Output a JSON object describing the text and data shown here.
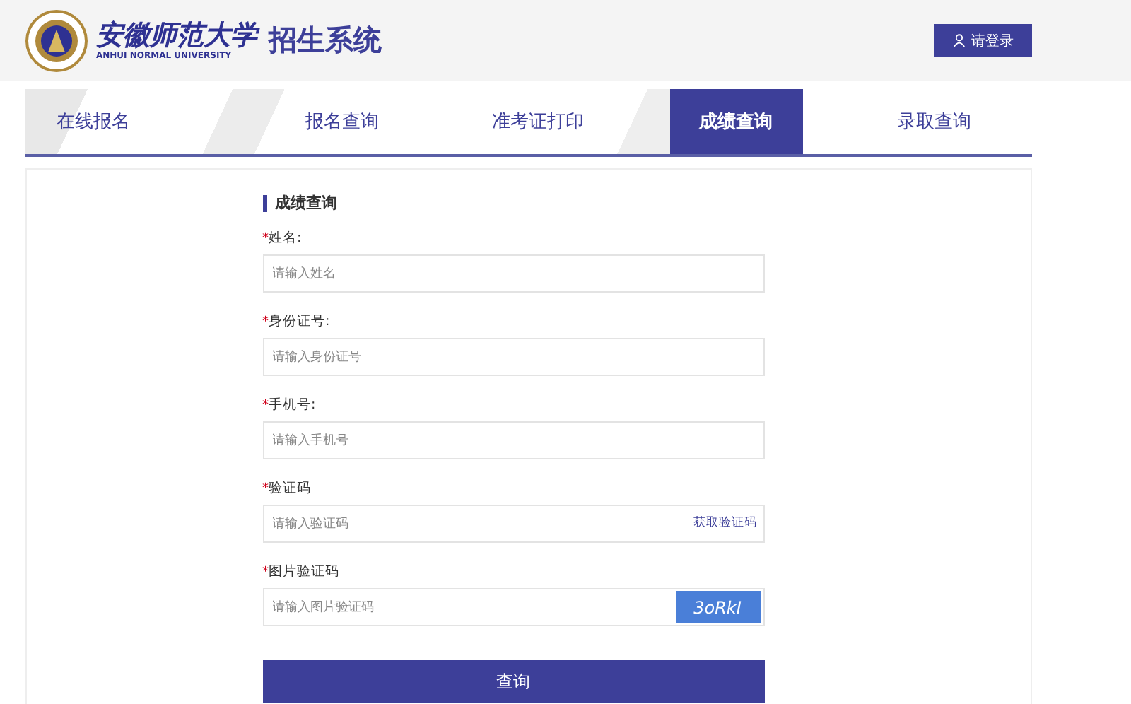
{
  "header": {
    "logo_name": "安徽师范大学",
    "logo_subtitle": "ANHUI NORMAL UNIVERSITY",
    "system_title": "招生系统",
    "login_button": "请登录"
  },
  "tabs": [
    {
      "label": "在线报名",
      "selected": false
    },
    {
      "label": "报名查询",
      "selected": false
    },
    {
      "label": "准考证打印",
      "selected": false
    },
    {
      "label": "成绩查询",
      "selected": true
    },
    {
      "label": "录取查询",
      "selected": false
    }
  ],
  "form": {
    "title": "成绩查询",
    "fields": [
      {
        "kind": "plain",
        "required_mark": "*",
        "label": "姓名:",
        "placeholder": "请输入姓名"
      },
      {
        "kind": "plain",
        "required_mark": "*",
        "label": "身份证号:",
        "placeholder": "请输入身份证号"
      },
      {
        "kind": "plain",
        "required_mark": "*",
        "label": "手机号:",
        "placeholder": "请输入手机号"
      },
      {
        "kind": "sms",
        "required_mark": "*",
        "label": "验证码",
        "placeholder": "请输入验证码",
        "action": "获取验证码"
      },
      {
        "kind": "captcha",
        "required_mark": "*",
        "label": "图片验证码",
        "placeholder": "请输入图片验证码",
        "captcha": "3oRkI"
      }
    ],
    "submit": "查询"
  }
}
